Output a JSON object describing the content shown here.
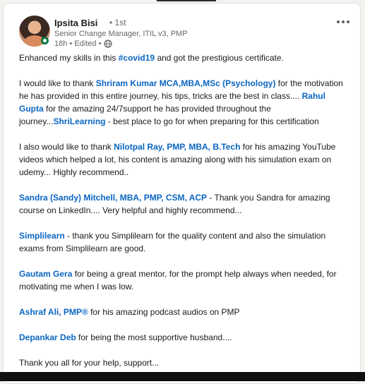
{
  "post": {
    "author": {
      "name": "Ipsita Bisi",
      "degree": "• 1st",
      "headline": "Senior Change Manager, ITIL v3, PMP",
      "meta": "18h • Edited •"
    },
    "body": {
      "p1_a": "Enhanced my skills in this ",
      "p1_hashtag": "#covid19",
      "p1_b": " and got the prestigious certificate.",
      "p2_a": "I would like to thank ",
      "p2_link1": "Shriram Kumar MCA,MBA,MSc (Psychology)",
      "p2_b": " for the motivation he has provided in this entire journey, his tips, tricks are the best in class.... ",
      "p2_link2": "Rahul Gupta",
      "p2_c": " for the amazing 24/7support he has provided throughout the journey...",
      "p2_link3": "ShriLearning",
      "p2_d": " - best place to go for when preparing for this certification",
      "p3_a": "I also would like to thank ",
      "p3_link": "Nilotpal Ray, PMP, MBA, B.Tech",
      "p3_b": " for his amazing YouTube videos which helped a lot, his content is amazing along with his simulation exam on udemy... Highly recommend..",
      "p4_link": "Sandra (Sandy) Mitchell, MBA, PMP, CSM, ACP",
      "p4_b": " - Thank you Sandra for amazing course on LinkedIn.... Very helpful and highly recommend...",
      "p5_link": "Simplilearn",
      "p5_b": " - thank you Simplilearn for the quality content and also the simulation exams from Simplilearn are good.",
      "p6_link": "Gautam Gera",
      "p6_b": " for being a great mentor, for the prompt help always when needed, for motivating me when I was low.",
      "p7_link": "Ashraf Ali, PMP®",
      "p7_b": " for his amazing podcast audios on PMP",
      "p8_link": "Depankar Deb",
      "p8_b": " for being the most supportive husband....",
      "p9": "Thank you all for your help, support..."
    }
  },
  "icons": {
    "visibility": "globe-icon",
    "menu": "more-options-icon",
    "presence": "online-status-icon"
  },
  "colors": {
    "link": "#0a66c2",
    "online": "#057642",
    "muted": "#666666"
  }
}
